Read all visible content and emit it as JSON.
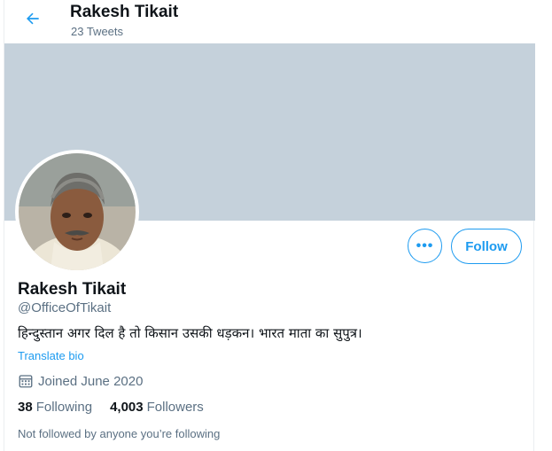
{
  "header": {
    "title": "Rakesh Tikait",
    "tweet_count": "23 Tweets"
  },
  "profile": {
    "name": "Rakesh Tikait",
    "handle": "@OfficeOfTikait",
    "bio": "हिन्दुस्तान अगर दिल है तो किसान उसकी धड़कन। भारत माता का सुपुत्र।",
    "translate_label": "Translate bio",
    "joined": "Joined June 2020",
    "following_count": "38",
    "following_label": "Following",
    "followers_count": "4,003",
    "followers_label": "Followers",
    "not_followed_text": "Not followed by anyone you’re following"
  },
  "actions": {
    "more_label": "•••",
    "follow_label": "Follow"
  },
  "colors": {
    "accent": "#1d9bf0",
    "banner": "#c5d1db",
    "secondary_text": "#5b7083"
  },
  "icons": {
    "back": "arrow-left-icon",
    "calendar": "calendar-icon",
    "more": "more-horizontal-icon"
  }
}
